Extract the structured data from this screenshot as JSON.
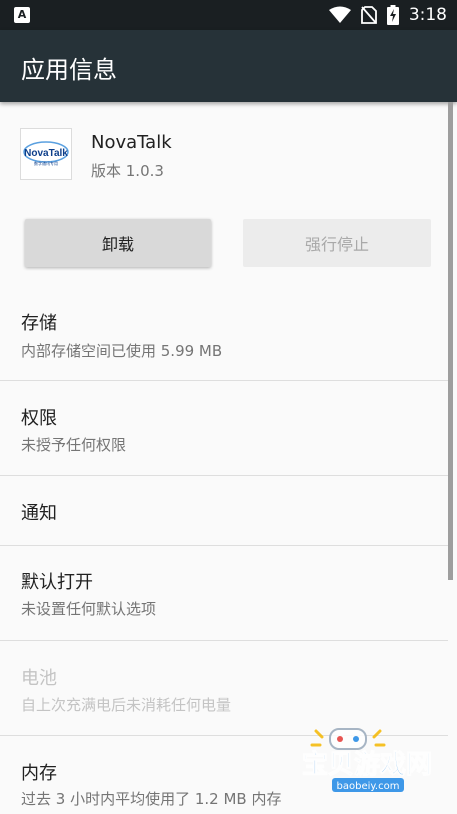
{
  "status_bar": {
    "left_icon": "A",
    "time": "3:18"
  },
  "app_bar": {
    "title": "应用信息"
  },
  "app": {
    "icon_text": "NovaTalk",
    "icon_subtext": "数字通讯专用",
    "name": "NovaTalk",
    "version": "版本 1.0.3"
  },
  "buttons": {
    "uninstall": "卸载",
    "force_stop": "强行停止"
  },
  "rows": [
    {
      "title": "存储",
      "subtitle": "内部存储空间已使用 5.99 MB",
      "enabled": true
    },
    {
      "title": "权限",
      "subtitle": "未授予任何权限",
      "enabled": true
    },
    {
      "title": "通知",
      "subtitle": "",
      "enabled": true
    },
    {
      "title": "默认打开",
      "subtitle": "未设置任何默认选项",
      "enabled": true
    },
    {
      "title": "电池",
      "subtitle": "自上次充满电后未消耗任何电量",
      "enabled": false
    },
    {
      "title": "内存",
      "subtitle": "过去 3 小时内平均使用了 1.2 MB 内存",
      "enabled": true
    }
  ],
  "watermark": {
    "text": "宝贝游戏网",
    "url_text": "baobeiy.com"
  },
  "colors": {
    "status_bar": "#1a1f22",
    "app_bar": "#263238",
    "background": "#fafafa",
    "brand_blue": "#0d3e8a"
  }
}
